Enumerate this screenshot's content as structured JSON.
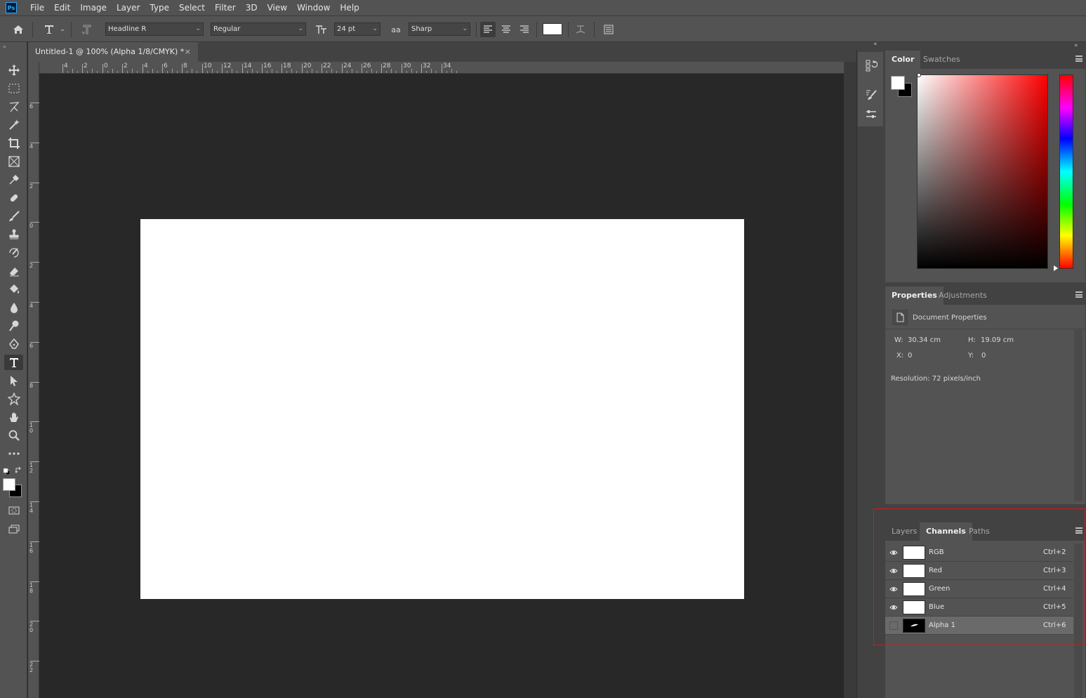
{
  "app": {
    "logo": "Ps"
  },
  "menu": [
    "File",
    "Edit",
    "Image",
    "Layer",
    "Type",
    "Select",
    "Filter",
    "3D",
    "View",
    "Window",
    "Help"
  ],
  "options": {
    "font_family": "Headline R",
    "font_style": "Regular",
    "font_size": "24 pt",
    "aa_label": "aa",
    "anti_alias": "Sharp",
    "text_color": "#ffffff"
  },
  "document": {
    "tab_title": "Untitled-1 @ 100% (Alpha 1/8/CMYK) *",
    "close": "×",
    "canvas_color": "#ffffff"
  },
  "rulers": {
    "h_ticks": [
      "4",
      "2",
      "0",
      "2",
      "4",
      "6",
      "8",
      "10",
      "12",
      "14",
      "16",
      "18",
      "20",
      "22",
      "24",
      "26",
      "28",
      "30",
      "32",
      "34"
    ],
    "v_ticks": [
      "6",
      "4",
      "2",
      "0",
      "2",
      "4",
      "6",
      "8",
      "10",
      "12",
      "14",
      "16",
      "18",
      "20",
      "22"
    ]
  },
  "color_panel": {
    "tabs": [
      "Color",
      "Swatches"
    ],
    "active_tab": "Color",
    "foreground": "#ffffff",
    "background": "#000000"
  },
  "properties_panel": {
    "tabs": [
      "Properties",
      "Adjustments"
    ],
    "active_tab": "Properties",
    "heading": "Document Properties",
    "w_label": "W:",
    "w_value": "30.34 cm",
    "h_label": "H:",
    "h_value": "19.09 cm",
    "x_label": "X:",
    "x_value": "0",
    "y_label": "Y:",
    "y_value": "0",
    "resolution": "Resolution: 72 pixels/inch"
  },
  "channels_panel": {
    "tabs": [
      "Layers",
      "Channels",
      "Paths"
    ],
    "active_tab": "Channels",
    "rows": [
      {
        "name": "RGB",
        "shortcut": "Ctrl+2",
        "visible": true,
        "selected": false
      },
      {
        "name": "Red",
        "shortcut": "Ctrl+3",
        "visible": true,
        "selected": false
      },
      {
        "name": "Green",
        "shortcut": "Ctrl+4",
        "visible": true,
        "selected": false
      },
      {
        "name": "Blue",
        "shortcut": "Ctrl+5",
        "visible": true,
        "selected": false
      },
      {
        "name": "Alpha 1",
        "shortcut": "Ctrl+6",
        "visible": false,
        "selected": true
      }
    ]
  },
  "colors": {
    "highlight": "#c81e1e",
    "ui_bg": "#535353",
    "dark_bg": "#282828"
  }
}
